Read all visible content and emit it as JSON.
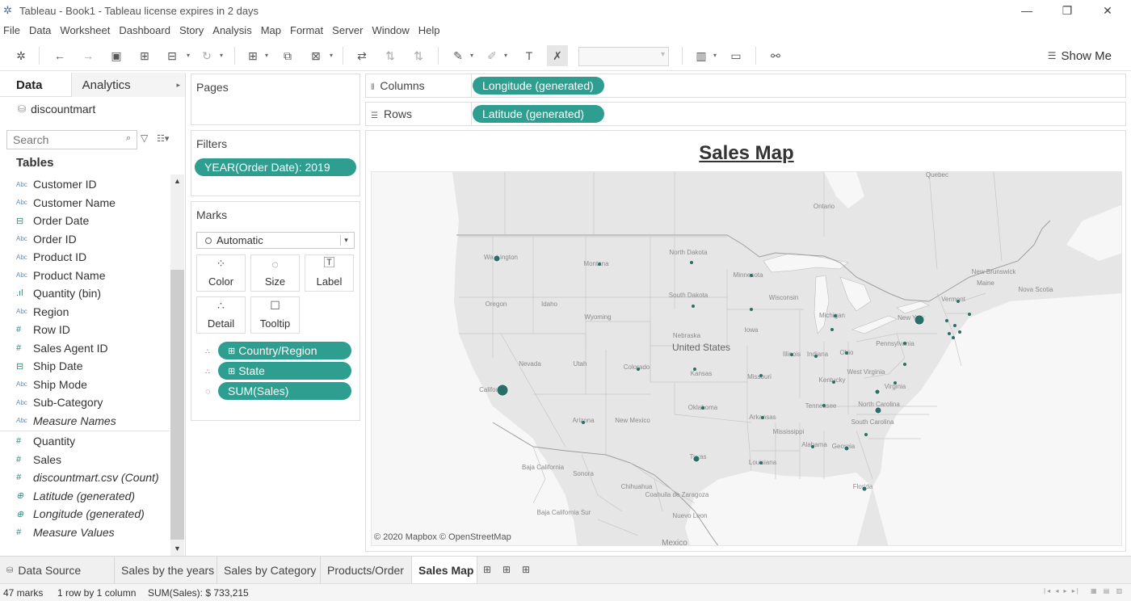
{
  "window": {
    "title": "Tableau - Book1 - Tableau license expires in 2 days",
    "controls": [
      "—",
      "❐",
      "✕"
    ]
  },
  "menu": [
    "File",
    "Data",
    "Worksheet",
    "Dashboard",
    "Story",
    "Analysis",
    "Map",
    "Format",
    "Server",
    "Window",
    "Help"
  ],
  "toolbar": {
    "show_me_label": "Show Me"
  },
  "data_pane": {
    "tab_data": "Data",
    "tab_analytics": "Analytics",
    "datasource": "discountmart",
    "search_placeholder": "Search",
    "tables_heading": "Tables",
    "dimensions": [
      {
        "type": "Abc",
        "name": "Customer ID",
        "italic": false
      },
      {
        "type": "Abc",
        "name": "Customer Name",
        "italic": false
      },
      {
        "type": "date",
        "name": "Order Date",
        "italic": false
      },
      {
        "type": "Abc",
        "name": "Order ID",
        "italic": false
      },
      {
        "type": "Abc",
        "name": "Product ID",
        "italic": false
      },
      {
        "type": "Abc",
        "name": "Product Name",
        "italic": false
      },
      {
        "type": "bin",
        "name": "Quantity (bin)",
        "italic": false
      },
      {
        "type": "Abc",
        "name": "Region",
        "italic": false
      },
      {
        "type": "#",
        "name": "Row ID",
        "italic": false
      },
      {
        "type": "#",
        "name": "Sales Agent ID",
        "italic": false
      },
      {
        "type": "date",
        "name": "Ship Date",
        "italic": false
      },
      {
        "type": "Abc",
        "name": "Ship Mode",
        "italic": false
      },
      {
        "type": "Abc",
        "name": "Sub-Category",
        "italic": false
      },
      {
        "type": "Abc",
        "name": "Measure Names",
        "italic": true
      }
    ],
    "measures": [
      {
        "type": "#",
        "name": "Quantity",
        "italic": false
      },
      {
        "type": "#",
        "name": "Sales",
        "italic": false
      },
      {
        "type": "#",
        "name": "discountmart.csv (Count)",
        "italic": true
      },
      {
        "type": "geo",
        "name": "Latitude (generated)",
        "italic": true
      },
      {
        "type": "geo",
        "name": "Longitude (generated)",
        "italic": true
      },
      {
        "type": "#",
        "name": "Measure Values",
        "italic": true
      }
    ]
  },
  "pages_card": {
    "title": "Pages"
  },
  "filters_card": {
    "title": "Filters",
    "pills": [
      "YEAR(Order Date): 2019"
    ]
  },
  "marks_card": {
    "title": "Marks",
    "mark_type": "Automatic",
    "buttons": [
      "Color",
      "Size",
      "Label",
      "Detail",
      "Tooltip"
    ],
    "fields": [
      {
        "role": "detail",
        "name": "Country/Region",
        "prefix": "⊞"
      },
      {
        "role": "detail",
        "name": "State",
        "prefix": "⊞"
      },
      {
        "role": "size",
        "name": "SUM(Sales)",
        "prefix": ""
      }
    ]
  },
  "shelves": {
    "columns_label": "Columns",
    "columns_pill": "Longitude (generated)",
    "rows_label": "Rows",
    "rows_pill": "Latitude (generated)"
  },
  "view": {
    "title": "Sales Map",
    "attribution": "© 2020 Mapbox © OpenStreetMap",
    "map_labels": [
      "Quebec",
      "Ontario",
      "Washington",
      "Montana",
      "North Dakota",
      "Minnesota",
      "Oregon",
      "Idaho",
      "South Dakota",
      "Wisconsin",
      "Michigan",
      "Wyoming",
      "New York",
      "Pennsylvania",
      "Nebraska",
      "Iowa",
      "Nevada",
      "Utah",
      "Colorado",
      "United States",
      "Kansas",
      "Missouri",
      "Illinois",
      "Indiana",
      "Ohio",
      "West Virginia",
      "Virginia",
      "Kentucky",
      "California",
      "Oklahoma",
      "Arkansas",
      "Tennessee",
      "North Carolina",
      "South Carolina",
      "Arizona",
      "New Mexico",
      "Mississippi",
      "Alabama",
      "Georgia",
      "Texas",
      "Louisiana",
      "Florida",
      "Baja California",
      "Sonora",
      "Chihuahua",
      "Coahuila de Zaragoza",
      "Nuevo Leon",
      "Baja California Sur",
      "Mexico",
      "New Brunswick",
      "Nova Scotia",
      "Maine",
      "Vermont"
    ],
    "marks_color": "#2a6e68",
    "accent_color": "#2d9e8f"
  },
  "sheet_tabs": {
    "datasource": "Data Source",
    "sheets": [
      "Sales by the years",
      "Sales by Category",
      "Products/Order",
      "Sales Map"
    ],
    "active": "Sales Map"
  },
  "status": {
    "marks": "47 marks",
    "rows_cols": "1 row by 1 column",
    "sum": "SUM(Sales): $ 733,215"
  }
}
